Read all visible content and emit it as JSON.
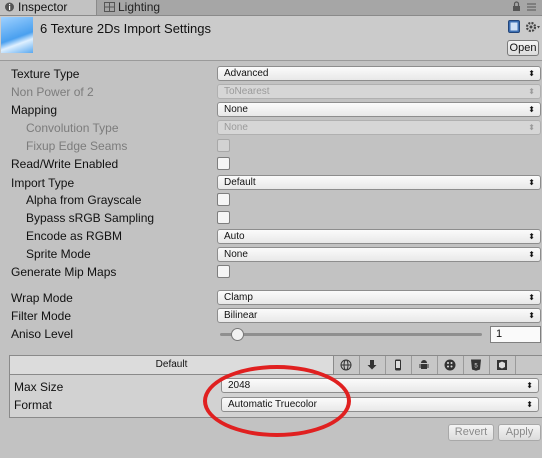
{
  "tabs": {
    "inspector": "Inspector",
    "lighting": "Lighting"
  },
  "header": {
    "title": "6 Texture 2Ds Import Settings",
    "open_label": "Open"
  },
  "rows": {
    "texture_type": {
      "label": "Texture Type",
      "value": "Advanced"
    },
    "non_power_of_2": {
      "label": "Non Power of 2",
      "value": "ToNearest"
    },
    "mapping": {
      "label": "Mapping",
      "value": "None"
    },
    "convolution_type": {
      "label": "Convolution Type",
      "value": "None"
    },
    "fixup_edge_seams": {
      "label": "Fixup Edge Seams"
    },
    "read_write_enabled": {
      "label": "Read/Write Enabled"
    },
    "import_type": {
      "label": "Import Type",
      "value": "Default"
    },
    "alpha_from_grayscale": {
      "label": "Alpha from Grayscale"
    },
    "bypass_srgb": {
      "label": "Bypass sRGB Sampling"
    },
    "encode_as_rgbm": {
      "label": "Encode as RGBM",
      "value": "Auto"
    },
    "sprite_mode": {
      "label": "Sprite Mode",
      "value": "None"
    },
    "generate_mip_maps": {
      "label": "Generate Mip Maps"
    },
    "wrap_mode": {
      "label": "Wrap Mode",
      "value": "Clamp"
    },
    "filter_mode": {
      "label": "Filter Mode",
      "value": "Bilinear"
    },
    "aniso_level": {
      "label": "Aniso Level",
      "value": "1"
    }
  },
  "platform": {
    "default_tab": "Default",
    "tab_icons": [
      "globe-icon",
      "download-icon",
      "phone-icon",
      "android-icon",
      "blackberry-icon",
      "html5-icon",
      "package-icon"
    ],
    "max_size": {
      "label": "Max Size",
      "value": "2048"
    },
    "format": {
      "label": "Format",
      "value": "Automatic Truecolor"
    }
  },
  "footer": {
    "revert_label": "Revert",
    "apply_label": "Apply"
  },
  "colors": {
    "annotation_red": "#e02020"
  }
}
